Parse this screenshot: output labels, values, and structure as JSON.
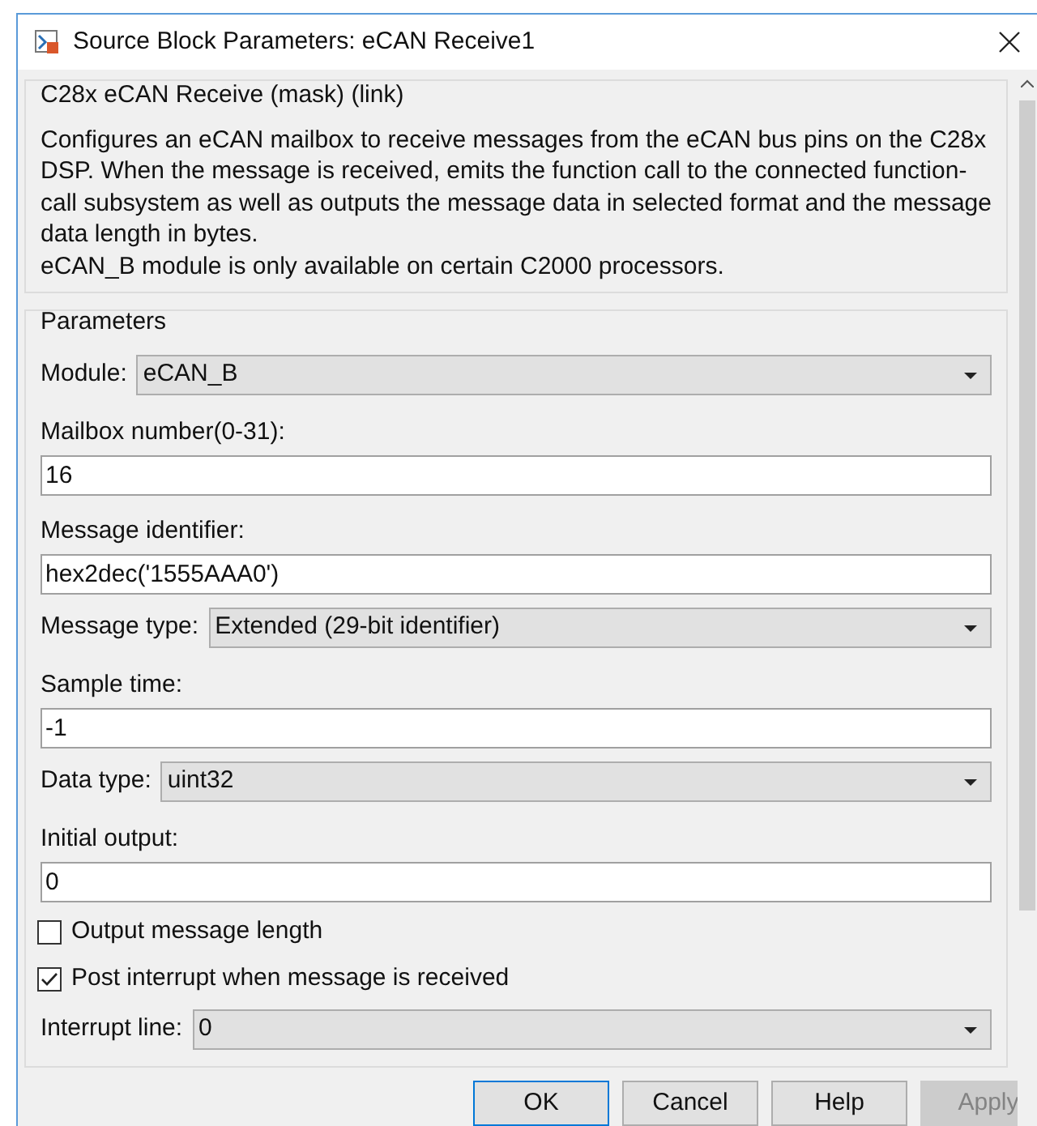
{
  "window": {
    "title": "Source Block Parameters: eCAN Receive1"
  },
  "mask": {
    "title": "C28x eCAN Receive (mask) (link)",
    "description": "Configures an eCAN mailbox to receive messages from the eCAN bus pins on the C28x DSP. When the message is received, emits the function call to the connected function-call subsystem as well as outputs the message data in selected format and the message data length in bytes.",
    "note": "eCAN_B module is only available on certain C2000 processors."
  },
  "parameters": {
    "title": "Parameters",
    "items": [
      {
        "kind": "dropdown",
        "label": "Module:",
        "value": "eCAN_B"
      },
      {
        "kind": "field",
        "label": "Mailbox number(0-31):",
        "value": "16"
      },
      {
        "kind": "field",
        "label": "Message identifier:",
        "value": "hex2dec('1555AAA0')"
      },
      {
        "kind": "dropdown",
        "label": "Message type:",
        "value": "Extended (29-bit identifier)"
      },
      {
        "kind": "field",
        "label": "Sample time:",
        "value": "-1"
      },
      {
        "kind": "dropdown",
        "label": "Data type:",
        "value": "uint32"
      },
      {
        "kind": "field",
        "label": "Initial output:",
        "value": "0"
      },
      {
        "kind": "checkbox",
        "label": "Output message length",
        "checked": false
      },
      {
        "kind": "checkbox",
        "label": "Post interrupt when message is received",
        "checked": true
      },
      {
        "kind": "dropdown",
        "label": "Interrupt line:",
        "value": "0"
      }
    ]
  },
  "buttons": [
    {
      "label": "OK",
      "default": true,
      "disabled": false
    },
    {
      "label": "Cancel",
      "default": false,
      "disabled": false
    },
    {
      "label": "Help",
      "default": false,
      "disabled": false
    },
    {
      "label": "Apply",
      "default": false,
      "disabled": true
    }
  ]
}
